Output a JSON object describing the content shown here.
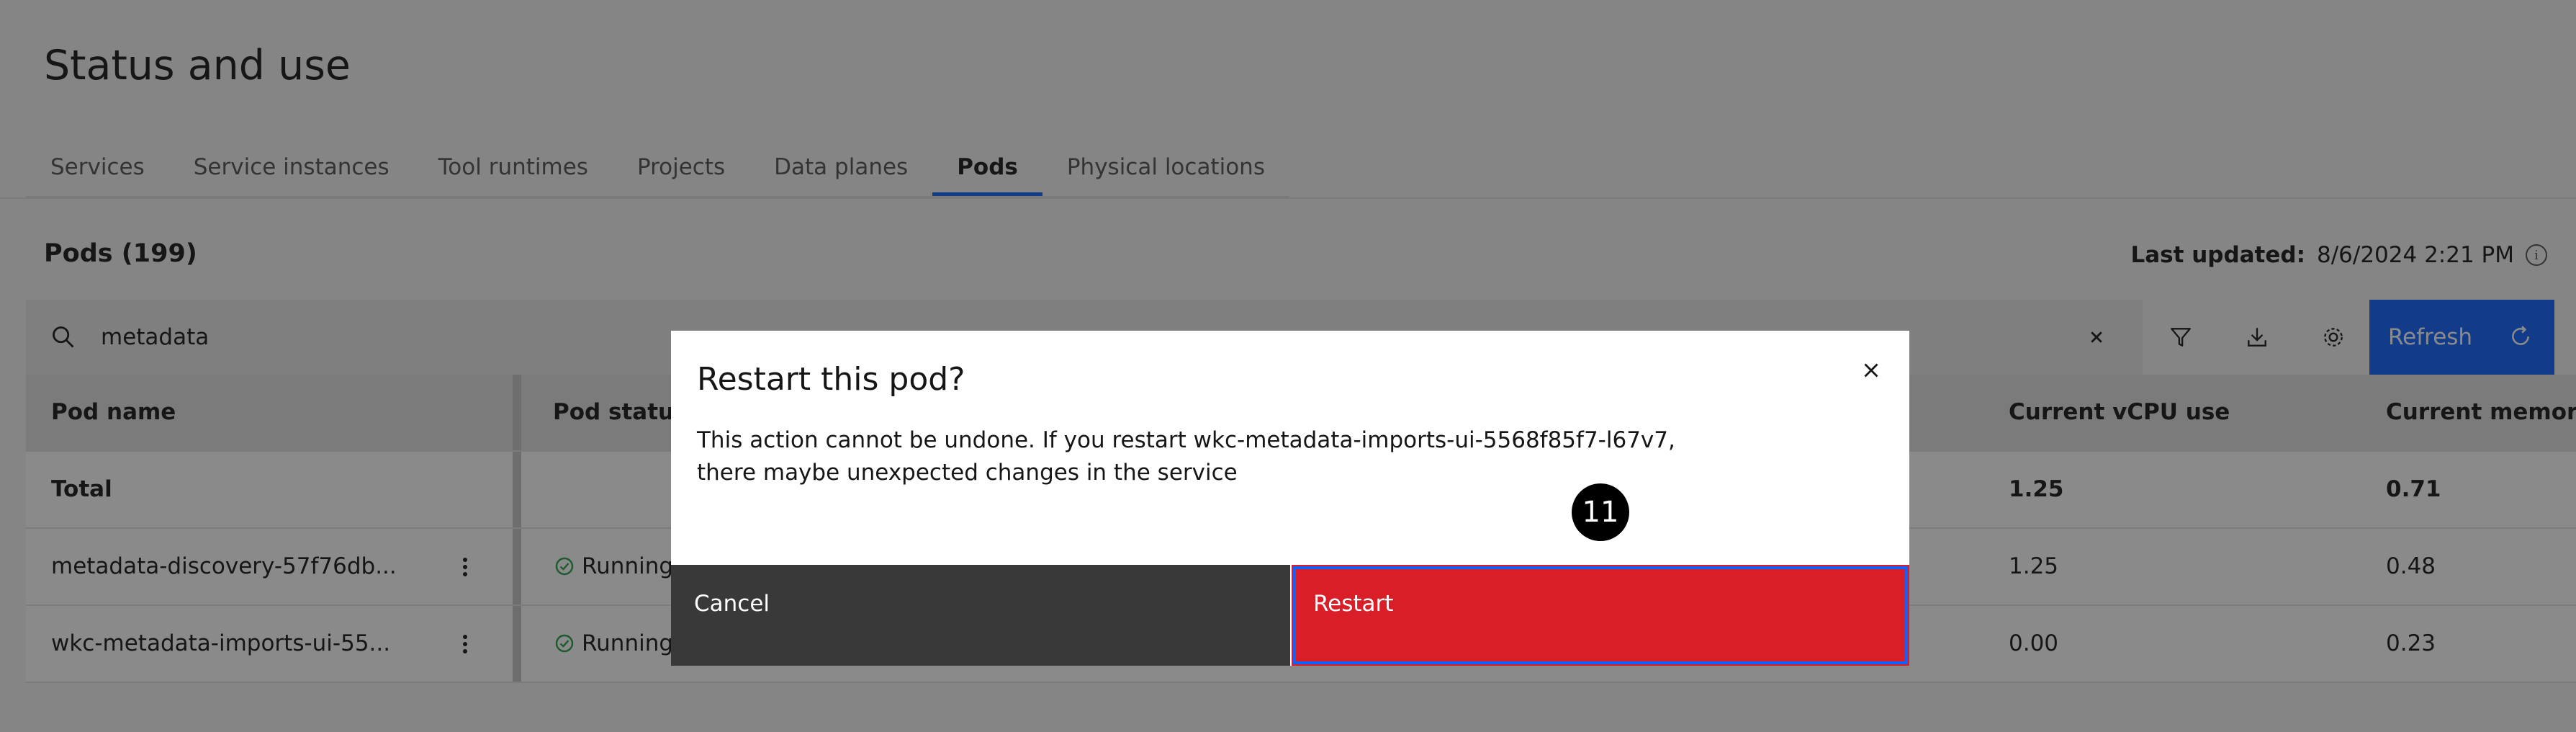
{
  "page": {
    "title": "Status and use"
  },
  "tabs": [
    {
      "label": "Services"
    },
    {
      "label": "Service instances"
    },
    {
      "label": "Tool runtimes"
    },
    {
      "label": "Projects"
    },
    {
      "label": "Data planes"
    },
    {
      "label": "Pods",
      "active": true
    },
    {
      "label": "Physical locations"
    }
  ],
  "section": {
    "title": "Pods (199)",
    "last_updated_label": "Last updated:",
    "last_updated_value": "8/6/2024 2:21 PM"
  },
  "search": {
    "value": "metadata"
  },
  "toolbar": {
    "refresh_label": "Refresh"
  },
  "table": {
    "columns": {
      "name": "Pod name",
      "status": "Pod status",
      "partial": "s",
      "cpu": "Current vCPU use",
      "memory": "Current memory"
    },
    "total": {
      "label": "Total",
      "cpu": "1.25",
      "memory": "0.71"
    },
    "rows": [
      {
        "name": "metadata-discovery-57f76db...",
        "status": "Running",
        "cpu": "1.25",
        "memory": "0.48"
      },
      {
        "name": "wkc-metadata-imports-ui-55...",
        "status": "Running",
        "cpu": "0.00",
        "memory": "0.23"
      }
    ]
  },
  "modal": {
    "title": "Restart this pod?",
    "body_line1": "This action cannot be undone. If you restart wkc-metadata-imports-ui-5568f85f7-l67v7,",
    "body_line2": "there maybe unexpected changes in the service",
    "cancel_label": "Cancel",
    "restart_label": "Restart",
    "step_marker": "11"
  },
  "colors": {
    "accent": "#0f62fe",
    "danger": "#da1e28",
    "success": "#24a148"
  }
}
